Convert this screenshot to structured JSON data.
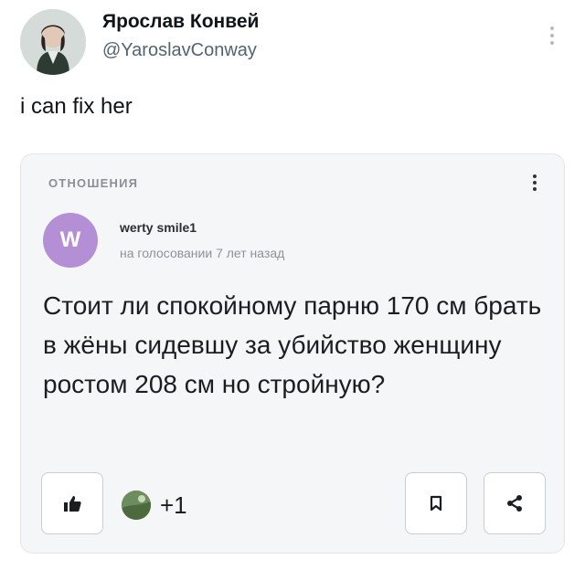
{
  "author": {
    "name": "Ярослав Конвей",
    "handle": "@YaroslavConway",
    "avatar_icon": "profile-photo-icon"
  },
  "tweet_text": "i can fix her",
  "card": {
    "category": "ОТНОШЕНИЯ",
    "user": {
      "avatar_letter": "W",
      "avatar_color": "#b58fd6",
      "name": "werty smile1",
      "meta": "на голосовании 7 лет назад"
    },
    "question": "Стоит ли спокойному парню 170 см брать в жёны сидевшу за убийство женщину ростом 208 см но стройную?",
    "likes": "+1"
  }
}
